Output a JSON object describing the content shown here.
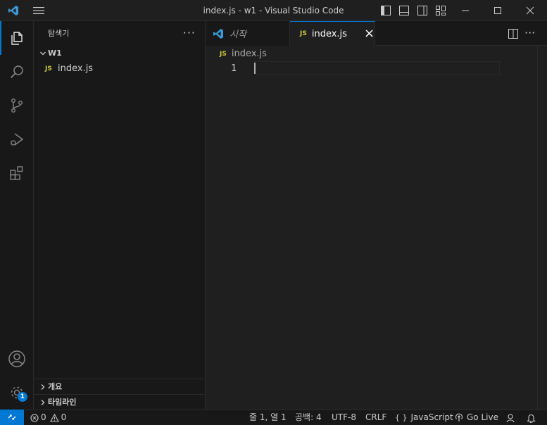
{
  "window": {
    "title": "index.js - w1 - Visual Studio Code"
  },
  "activity_bar": {
    "items": [
      {
        "name": "explorer-icon",
        "active": true
      },
      {
        "name": "search-icon",
        "active": false
      },
      {
        "name": "source-control-icon",
        "active": false
      },
      {
        "name": "run-debug-icon",
        "active": false
      },
      {
        "name": "extensions-icon",
        "active": false
      }
    ],
    "bottom": [
      {
        "name": "account-icon"
      },
      {
        "name": "manage-gear-icon",
        "badge": "1"
      }
    ]
  },
  "sidebar": {
    "title": "탐색기",
    "more": "···",
    "folder": "W1",
    "file_badge": "JS",
    "file": "index.js",
    "sections": [
      "개요",
      "타임라인"
    ]
  },
  "tabs": [
    {
      "label": "시작",
      "active": false,
      "icon": "vscode-logo-icon"
    },
    {
      "label": "index.js",
      "active": true,
      "badge": "JS",
      "close": "×"
    }
  ],
  "editor": {
    "breadcrumb_badge": "JS",
    "breadcrumb_file": "index.js",
    "line_number": "1"
  },
  "status_bar": {
    "errors": "0",
    "warnings": "0",
    "position": "줄 1, 열 1",
    "indent": "공백: 4",
    "encoding": "UTF-8",
    "eol": "CRLF",
    "language_braces": "{ }",
    "language": "JavaScript",
    "golive": "Go Live"
  },
  "colors": {
    "accent": "#0078d4",
    "js_yellow": "#cbcb41",
    "vscode_blue": "#3c99d4"
  }
}
